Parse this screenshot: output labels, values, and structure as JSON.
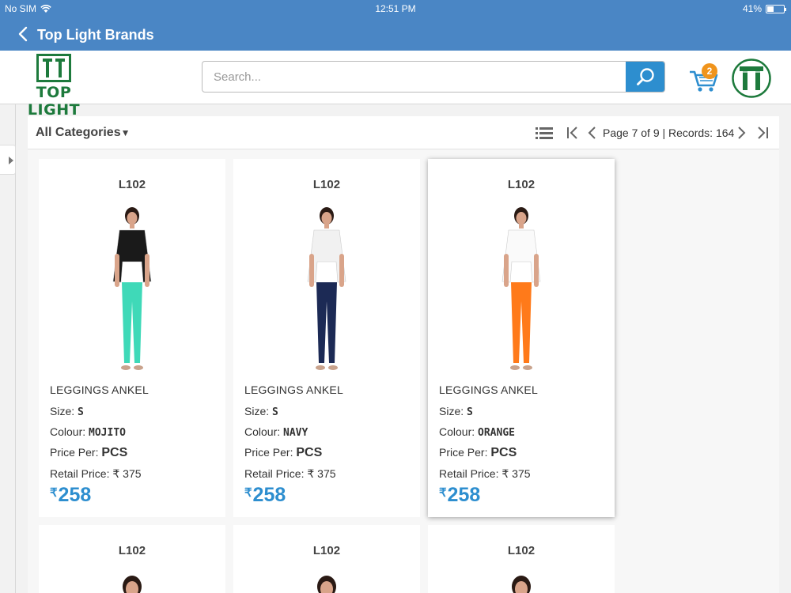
{
  "status_bar": {
    "carrier": "No SIM",
    "time": "12:51 PM",
    "battery": "41%",
    "battery_level": 0.41
  },
  "nav": {
    "title": "Top Light Brands"
  },
  "header": {
    "logo_text": "TOP LIGHT",
    "search_placeholder": "Search...",
    "search_value": "",
    "cart_count": "2",
    "brand_color": "#1d7a3c",
    "accent_color": "#2d8ecf",
    "badge_color": "#f0941c"
  },
  "toolbar": {
    "category": "All Categories",
    "page_info": "Page 7 of 9 | Records: 164"
  },
  "labels": {
    "size": "Size:",
    "colour": "Colour:",
    "price_per": "Price Per:",
    "retail": "Retail Price:",
    "currency": "₹"
  },
  "products": [
    {
      "code": "L102",
      "name": "LEGGINGS ANKEL",
      "size": "S",
      "colour": "MOJITO",
      "price_per": "PCS",
      "retail": "₹ 375",
      "price": "258",
      "selected": false,
      "top_color": "#1a1a1a",
      "bottom_color": "#3fd9b8"
    },
    {
      "code": "L102",
      "name": "LEGGINGS ANKEL",
      "size": "S",
      "colour": "NAVY",
      "price_per": "PCS",
      "retail": "₹ 375",
      "price": "258",
      "selected": false,
      "top_color": "#f1f1f1",
      "bottom_color": "#1c2a55"
    },
    {
      "code": "L102",
      "name": "LEGGINGS ANKEL",
      "size": "S",
      "colour": "ORANGE",
      "price_per": "PCS",
      "retail": "₹ 375",
      "price": "258",
      "selected": true,
      "top_color": "#fafafa",
      "bottom_color": "#ff7a1a"
    }
  ],
  "next_row": [
    {
      "code": "L102"
    },
    {
      "code": "L102"
    },
    {
      "code": "L102"
    }
  ]
}
